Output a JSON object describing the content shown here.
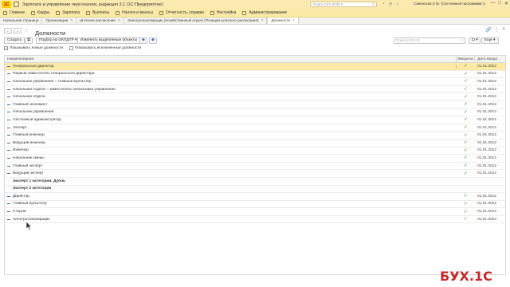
{
  "titlebar": {
    "logo": "1С",
    "title": "Зарплата и управление персоналом, редакция 3.1  (1С:Предприятие)",
    "search_placeholder": "Поиск Ctrl+Shift+F",
    "user": "Савенская З.Ю. (Системный программист)",
    "min": "—",
    "max": "□",
    "close": "✕"
  },
  "sections": [
    {
      "label": "Главное"
    },
    {
      "label": "Кадры"
    },
    {
      "label": "Зарплата"
    },
    {
      "label": "Выплаты"
    },
    {
      "label": "Налоги и взносы"
    },
    {
      "label": "Отчетность, справки"
    },
    {
      "label": "Настройка"
    },
    {
      "label": "Администрирование"
    }
  ],
  "tabs": [
    {
      "label": "Начальная страница"
    },
    {
      "label": "Организации"
    },
    {
      "label": "Штатное расписание"
    },
    {
      "label": "Электрогазосварщик (Хозяйственный отдел) (Позиция штатного расписания)"
    },
    {
      "label": "Должности",
      "active": true
    }
  ],
  "form": {
    "title": "Должности",
    "back": "←",
    "forward": "→",
    "star": "☆",
    "link": "🔗",
    "more": "⋮",
    "close": "×"
  },
  "toolbar": {
    "create": "Создать",
    "okpdtr": "Подбор из ОКПДТР",
    "mark_delete": "Изменить выделенные объекты",
    "search_placeholder": "Поиск (Ctrl+F)",
    "search_btn": "Q",
    "more": "Еще"
  },
  "checks": {
    "show_new": "Показывать новые должности",
    "show_excluded": "Показывать исключенные должности"
  },
  "table": {
    "col_name": "Наименование",
    "col_intro": "Введена",
    "col_date": "Дата ввода",
    "rows": [
      {
        "name": "Генеральный директор",
        "intro": "✓",
        "date": "01.01.2012",
        "selected": true
      },
      {
        "name": "Первый заместитель генерального директора",
        "intro": "✓",
        "date": "01.01.2012"
      },
      {
        "name": "Начальник управления – главный бухгалтер",
        "intro": "✓",
        "date": "01.01.2012"
      },
      {
        "name": "Начальник отдела – заместитель начальника управления",
        "intro": "✓",
        "date": "01.01.2012"
      },
      {
        "name": "Начальник отдела",
        "intro": "✓",
        "date": "01.01.2012"
      },
      {
        "name": "Главный экономист",
        "intro": "✓",
        "date": "01.01.2012"
      },
      {
        "name": "Начальник управления",
        "intro": "✓",
        "date": "01.01.2012"
      },
      {
        "name": "Системный администратор",
        "intro": "✓",
        "date": "01.01.2012"
      },
      {
        "name": "Эксперт",
        "intro": "✓",
        "date": "01.01.2012"
      },
      {
        "name": "Главный инженер",
        "intro": "✓",
        "date": "01.01.2012"
      },
      {
        "name": "Ведущий инженер",
        "intro": "✓",
        "date": "01.01.2012"
      },
      {
        "name": "Инженер",
        "intro": "✓",
        "date": "01.01.2012"
      },
      {
        "name": "Начальник смены",
        "intro": "✓",
        "date": "01.01.2012"
      },
      {
        "name": "Главный эксперт",
        "intro": "✓",
        "date": "01.01.2012"
      },
      {
        "name": "Ведущий эксперт",
        "intro": "✓",
        "date": "01.01.2012"
      },
      {
        "name": "Эксперт 1 категории, Дубль",
        "intro": "",
        "date": "",
        "group": true
      },
      {
        "name": "Эксперт 2 категории",
        "intro": "",
        "date": "",
        "group": true
      },
      {
        "name": "Директор",
        "intro": "✓",
        "date": "01.01.2012"
      },
      {
        "name": "Главный бухгалтер",
        "intro": "✓",
        "date": "01.01.2012"
      },
      {
        "name": "Сторож",
        "intro": "✓",
        "date": "01.01.2012"
      },
      {
        "name": "Электрогазосварщик",
        "intro": "✓",
        "date": "01.01.2023"
      }
    ]
  },
  "watermark": "БУХ.1С",
  "colors": {
    "accent_yellow": "#fbe9a6",
    "selected_row": "#fbeaa3",
    "check_green": "#2b8a3e",
    "watermark_red": "#c62828"
  }
}
